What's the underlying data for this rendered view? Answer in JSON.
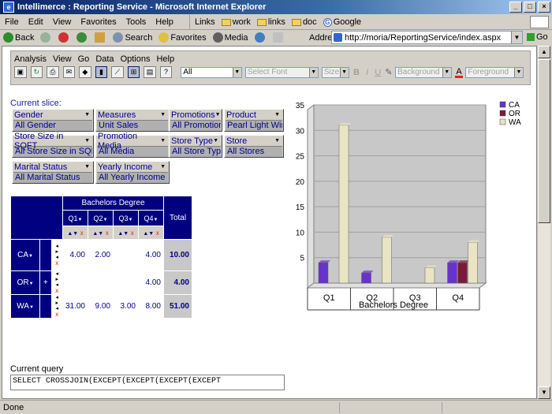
{
  "window": {
    "title": "Intellimerce : Reporting Service - Microsoft Internet Explorer",
    "buttons": {
      "minimize": "_",
      "maximize": "□",
      "close": "×"
    }
  },
  "menubar": {
    "items": [
      "File",
      "Edit",
      "View",
      "Favorites",
      "Tools",
      "Help"
    ],
    "links_label": "Links",
    "links": [
      "work",
      "links",
      "doc",
      "Google"
    ]
  },
  "toolbar": {
    "back": "Back",
    "search": "Search",
    "favorites": "Favorites",
    "media": "Media",
    "address_label": "Address",
    "address_value": "http://moria/ReportingService/index.aspx",
    "go": "Go"
  },
  "app": {
    "menu": [
      "Analysis",
      "View",
      "Go",
      "Data",
      "Options",
      "Help"
    ],
    "filter_select": "All",
    "font_select": "Select Font",
    "size_select": "Size",
    "fmt_bold": "B",
    "fmt_italic": "I",
    "fmt_underline": "U",
    "background_select": "Background",
    "foreground_select": "Foreground"
  },
  "slice": {
    "label": "Current slice:",
    "dimensions": [
      {
        "name": "Gender",
        "value": "All Gender"
      },
      {
        "name": "Measures",
        "value": "Unit Sales"
      },
      {
        "name": "Promotions",
        "value": "All Promotions"
      },
      {
        "name": "Product",
        "value": "Pearl Light Wine"
      },
      {
        "name": "Store Size in SQFT",
        "value": "All Store Size in SQFT"
      },
      {
        "name": "Promotion Media",
        "value": "All Media"
      },
      {
        "name": "Store Type",
        "value": "All Store Type"
      },
      {
        "name": "Store",
        "value": "All Stores"
      },
      {
        "name": "Marital Status",
        "value": "All Marital Status"
      },
      {
        "name": "Yearly Income",
        "value": "All Yearly Income"
      }
    ]
  },
  "grid": {
    "column_group": "Bachelors Degree",
    "total_label": "Total",
    "columns": [
      "Q1",
      "Q2",
      "Q3",
      "Q4"
    ],
    "rows": [
      {
        "label": "CA",
        "values": [
          "4.00",
          "2.00",
          "",
          "4.00"
        ],
        "total": "10.00",
        "expand": ""
      },
      {
        "label": "OR",
        "values": [
          "",
          "",
          "",
          "4.00"
        ],
        "total": "4.00",
        "expand": "+"
      },
      {
        "label": "WA",
        "values": [
          "31.00",
          "9.00",
          "3.00",
          "8.00"
        ],
        "total": "51.00",
        "expand": ""
      }
    ]
  },
  "query": {
    "label": "Current query",
    "text": "SELECT CROSSJOIN(EXCEPT(EXCEPT(EXCEPT(EXCEPT"
  },
  "status": {
    "text": "Done"
  },
  "colors": {
    "CA": "#6633cc",
    "OR": "#7a1a3a",
    "WA": "#e8e4c4"
  },
  "chart_data": {
    "type": "bar",
    "categories": [
      "Q1",
      "Q2",
      "Q3",
      "Q4"
    ],
    "series": [
      {
        "name": "CA",
        "values": [
          4,
          2,
          0,
          4
        ]
      },
      {
        "name": "OR",
        "values": [
          0,
          0,
          0,
          4
        ]
      },
      {
        "name": "WA",
        "values": [
          31,
          9,
          3,
          8
        ]
      }
    ],
    "xlabel": "Bachelors Degree",
    "ylabel": "",
    "ylim": [
      0,
      35
    ],
    "yticks": [
      5,
      10,
      15,
      20,
      25,
      30,
      35
    ],
    "grid": true,
    "legend_position": "top-right"
  }
}
